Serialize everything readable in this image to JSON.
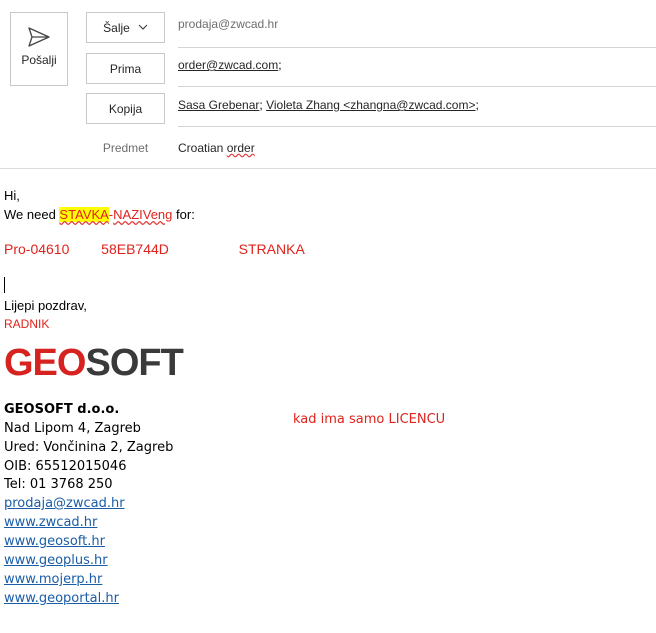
{
  "header": {
    "send_label": "Pošalji",
    "from_button": "Šalje",
    "from_value": "prodaja@zwcad.hr",
    "to_button": "Prima",
    "to_value": "order@zwcad.com",
    "to_suffix": ";",
    "cc_button": "Kopija",
    "cc_recipient_1": "Sasa Grebenar",
    "cc_sep": "; ",
    "cc_recipient_2": "Violeta Zhang <zhangna@zwcad.com>",
    "cc_suffix": ";",
    "subject_label": "Predmet",
    "subject_word_1": "Croatian",
    "subject_word_2": "order"
  },
  "body": {
    "greeting": "Hi,",
    "need_prefix": "We need ",
    "stavka": "STAVKA",
    "dash": "-",
    "naziv": "NAZIVeng",
    "for_text": " for:",
    "code": "Pro-04610",
    "key": "58EB744D",
    "customer": "STRANKA",
    "regards": "Lijepi pozdrav,",
    "worker": "RADNIK",
    "note": "kad ima samo LICENCU"
  },
  "logo": {
    "part_red": "GEO",
    "part_dark": "SOFT"
  },
  "signature": {
    "company": "GEOSOFT d.o.o.",
    "address": "Nad Lipom 4, Zagreb",
    "office": "Ured: Vončinina 2, Zagreb",
    "oib": "OIB: 65512015046",
    "tel": "Tel: 01 3768 250",
    "links": [
      "prodaja@zwcad.hr",
      "www.zwcad.hr",
      "www.geosoft.hr",
      "www.geoplus.hr",
      "www.mojerp.hr",
      "www.geoportal.hr"
    ]
  },
  "colors": {
    "red": "#e0221c",
    "link": "#1a5da6",
    "highlight": "#ffff00"
  }
}
